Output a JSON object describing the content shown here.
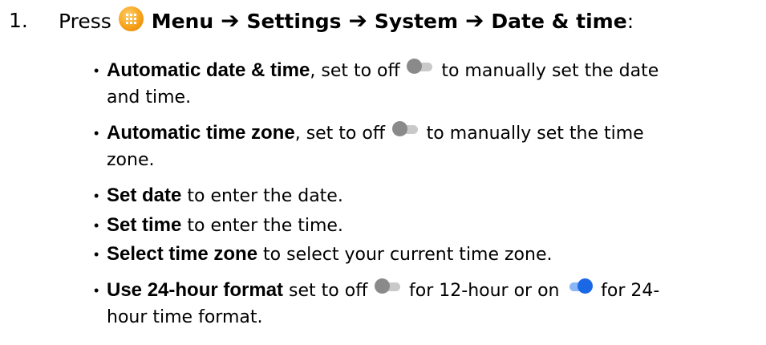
{
  "step": {
    "number": "1.",
    "press": "Press",
    "menu": "Menu",
    "settings": "Settings",
    "system": "System",
    "date_time": "Date & time",
    "colon": ":"
  },
  "icons": {
    "menu_icon": "menu-grid-icon",
    "arrow": "arrow-right-icon",
    "toggle_off": "toggle-off-icon",
    "toggle_on": "toggle-on-icon",
    "menu_icon_color": "#f7a21a",
    "toggle_on_color": "#1a68e6",
    "toggle_off_color": "#8a8a8a"
  },
  "bullets": [
    {
      "bold": "Automatic date & time",
      "pre": ", set to off",
      "post": " to manually set the date",
      "line2": "and time."
    },
    {
      "bold": "Automatic time zone",
      "pre": ", set to off",
      "post": " to manually set the time",
      "line2": "zone."
    },
    {
      "bold": "Set date",
      "text": " to enter the date."
    },
    {
      "bold": "Set time",
      "text": " to enter the time."
    },
    {
      "bold": "Select time zone",
      "text": " to select your current time zone."
    },
    {
      "bold": "Use 24-hour format",
      "pre": " set to off",
      "mid": " for 12-hour or on",
      "post": " for 24-",
      "line2": "hour time format."
    }
  ]
}
